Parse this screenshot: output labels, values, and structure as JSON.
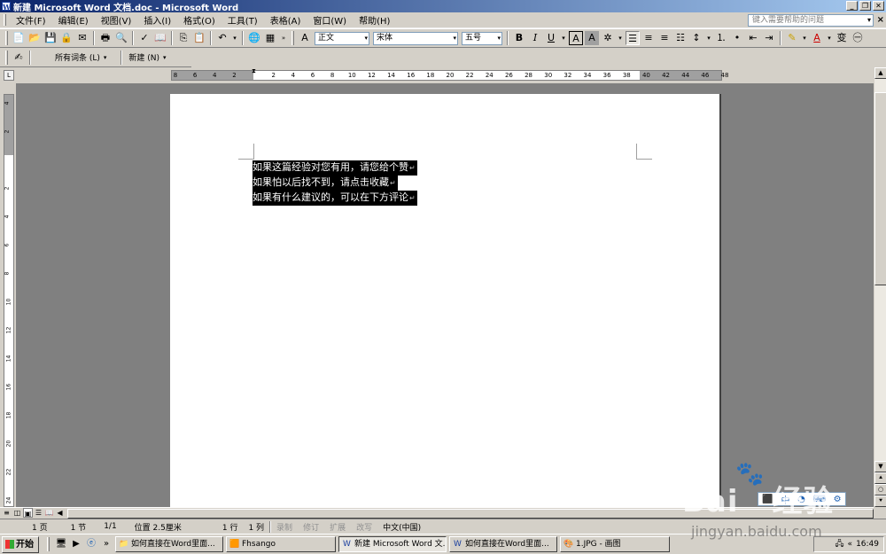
{
  "titlebar": {
    "title": "新建 Microsoft Word 文档.doc - Microsoft Word",
    "app_icon": "word-icon",
    "btn_minimize": "_",
    "btn_restore": "❐",
    "btn_close": "✕"
  },
  "menubar": {
    "items": [
      {
        "label": "文件(F)"
      },
      {
        "label": "编辑(E)"
      },
      {
        "label": "视图(V)"
      },
      {
        "label": "插入(I)"
      },
      {
        "label": "格式(O)"
      },
      {
        "label": "工具(T)"
      },
      {
        "label": "表格(A)"
      },
      {
        "label": "窗口(W)"
      },
      {
        "label": "帮助(H)"
      }
    ],
    "help_placeholder": "键入需要帮助的问题",
    "close_doc": "×"
  },
  "toolbar_standard": {
    "icons": [
      "new-icon",
      "open-icon",
      "save-icon",
      "permission-icon",
      "email-icon",
      "print-icon",
      "print-preview-icon",
      "spelling-icon",
      "research-icon",
      "cut-icon",
      "copy-icon",
      "paste-icon",
      "undo-icon",
      "hyperlink-icon",
      "table-icon"
    ]
  },
  "toolbar_format": {
    "style": "正文",
    "font": "宋体",
    "size": "五号",
    "bold": "B",
    "italic": "I",
    "underline": "U",
    "char_border": "A",
    "char_shading": "A"
  },
  "toolbar_reviewing": {
    "show_markup": "所有词条 (L)",
    "new_comment": "新建 (N)"
  },
  "ruler": {
    "corner": "L",
    "h_numbers": [
      "8",
      "6",
      "4",
      "2",
      "",
      "2",
      "4",
      "6",
      "8",
      "10",
      "12",
      "14",
      "16",
      "18",
      "20",
      "22",
      "24",
      "26",
      "28",
      "30",
      "32",
      "34",
      "36",
      "38",
      "40",
      "42",
      "44",
      "46",
      "48"
    ],
    "v_numbers": [
      "4",
      "2",
      "",
      "2",
      "4",
      "6",
      "8",
      "10",
      "12",
      "14",
      "16",
      "18",
      "20",
      "22",
      "24"
    ]
  },
  "document": {
    "lines": [
      "如果这篇经验对您有用，请您给个赞",
      "如果怕以后找不到，请点击收藏",
      "如果有什么建议的，可以在下方评论"
    ],
    "paragraph_mark": "↵"
  },
  "statusbar": {
    "page": "1 页",
    "section": "1 节",
    "page_of": "1/1",
    "position": "位置 2.5厘米",
    "line": "1 行",
    "column": "1 列",
    "rec": "录制",
    "trk": "修订",
    "ext": "扩展",
    "ovr": "改写",
    "language": "中文(中国)"
  },
  "taskbar": {
    "start": "开始",
    "tasks": [
      {
        "label": "如何直接在Word里面...",
        "icon": "folder-icon",
        "active": false
      },
      {
        "label": "Fhsango",
        "icon": "app-icon",
        "active": false
      },
      {
        "label": "新建 Microsoft Word 文...",
        "icon": "word-icon",
        "active": true
      },
      {
        "label": "如何直接在Word里面...",
        "icon": "word-icon",
        "active": false
      },
      {
        "label": "1.JPG - 画图",
        "icon": "paint-icon",
        "active": false
      }
    ],
    "clock": "16:49"
  },
  "watermark": {
    "brand": "Bai",
    "brand2": "经验",
    "url": "jingyan.baidu.com"
  }
}
